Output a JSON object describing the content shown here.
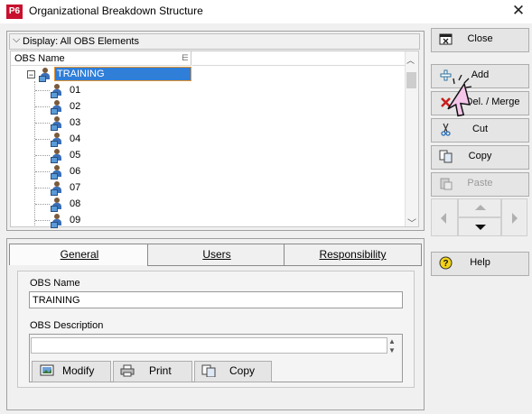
{
  "window": {
    "app_logo": "P6",
    "title": "Organizational Breakdown Structure",
    "close_glyph": "✕"
  },
  "display_bar": {
    "label": "Display: All OBS Elements"
  },
  "grid": {
    "column_header": "OBS Name",
    "root": "TRAINING",
    "children": [
      "01",
      "02",
      "03",
      "04",
      "05",
      "06",
      "07",
      "08",
      "09"
    ]
  },
  "tabs": {
    "general": "General",
    "users": "Users",
    "responsibility": "Responsibility",
    "active": "General"
  },
  "general": {
    "obs_name_label": "OBS Name",
    "obs_name_value": "TRAINING",
    "obs_description_label": "OBS Description",
    "obs_description_value": "",
    "modify_label": "Modify",
    "print_label": "Print",
    "copy_label": "Copy"
  },
  "right_buttons": {
    "close": "Close",
    "add": "Add",
    "delete_merge": "Del. / Merge",
    "cut": "Cut",
    "copy": "Copy",
    "paste": "Paste",
    "help": "Help"
  },
  "icons": {
    "close": "close-window-icon",
    "add": "plus-icon",
    "delete_merge": "red-x-icon",
    "cut": "scissors-icon",
    "copy": "copy-icon",
    "paste": "paste-icon",
    "help": "help-icon"
  },
  "colors": {
    "selection": "#2f7ed8",
    "selection_border": "#e3932e",
    "logo": "#c8102e"
  }
}
